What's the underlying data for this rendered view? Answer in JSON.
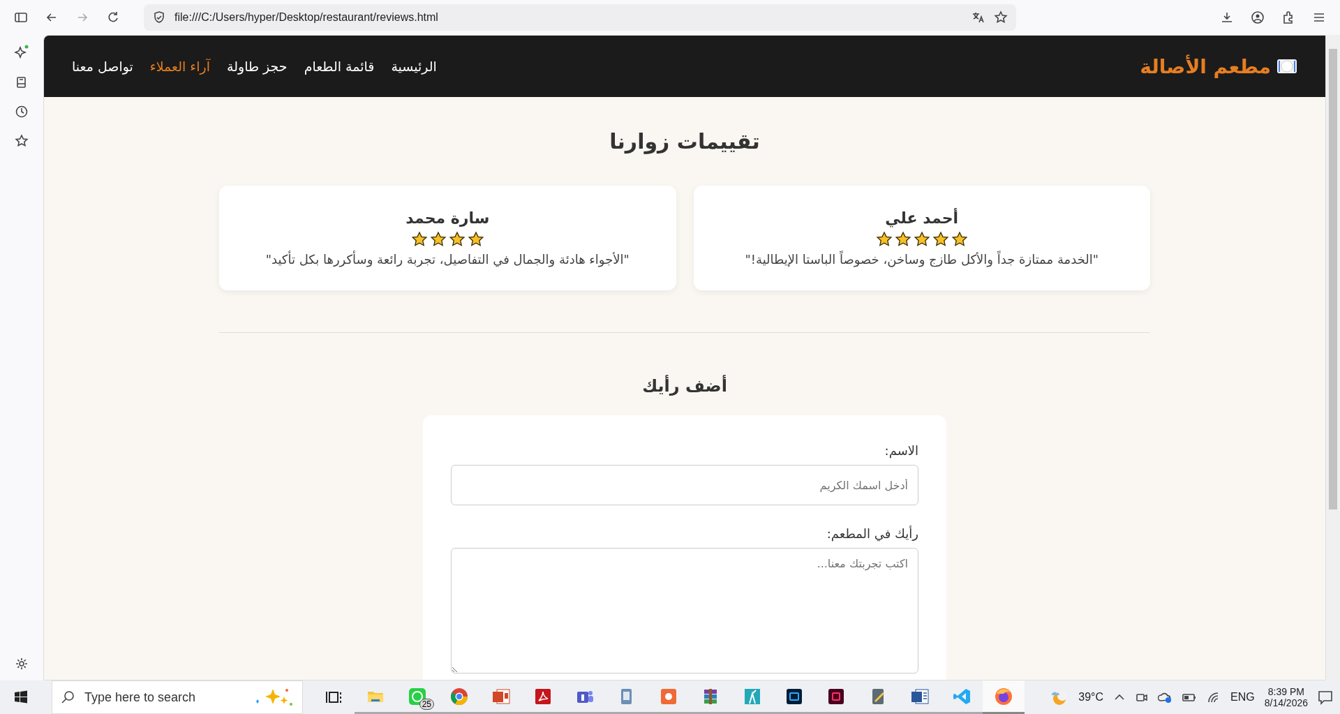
{
  "browser": {
    "url": "file:///C:/Users/hyper/Desktop/restaurant/reviews.html"
  },
  "nav": {
    "logo": "مطعم الأصالة",
    "links": [
      {
        "label": "الرئيسية",
        "selected": false
      },
      {
        "label": "قائمة الطعام",
        "selected": false
      },
      {
        "label": "حجز طاولة",
        "selected": false
      },
      {
        "label": "آراء العملاء",
        "selected": true
      },
      {
        "label": "تواصل معنا",
        "selected": false
      }
    ]
  },
  "reviews": {
    "title": "تقييمات زوارنا",
    "items": [
      {
        "name": "أحمد علي",
        "stars": 5,
        "quote": "\"الخدمة ممتازة جداً والأكل طازج وساخن، خصوصاً الباستا الإيطالية!\""
      },
      {
        "name": "سارة محمد",
        "stars": 4,
        "quote": "\"الأجواء هادئة والجمال في التفاصيل، تجربة رائعة وسأكررها بكل تأكيد\""
      }
    ]
  },
  "form": {
    "title": "أضف رأيك",
    "fields": [
      {
        "kind": "input",
        "label": "الاسم:",
        "placeholder": "أدخل اسمك الكريم"
      },
      {
        "kind": "textarea",
        "label": "رأيك في المطعم:",
        "placeholder": "اكتب تجربتك معنا..."
      }
    ]
  },
  "taskbar": {
    "search_placeholder": "Type here to search",
    "whatsapp_badge": "25",
    "weather": "39°C",
    "language": "ENG",
    "time": "8:39 PM",
    "date": "8/14/2026"
  }
}
